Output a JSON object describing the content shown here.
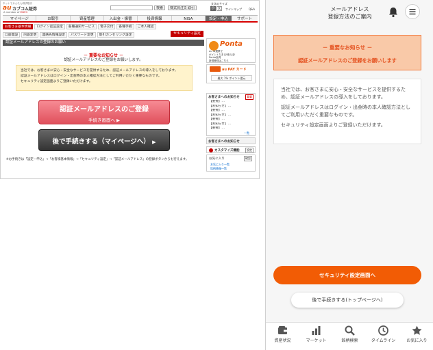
{
  "desktop": {
    "brand": {
      "small_text": "ネットでかんたん株式取引",
      "logo_au": "au",
      "logo_name": "カブコム証券",
      "member": "A member of",
      "mufg": "MUFG"
    },
    "search": {
      "button": "検索",
      "stock_price": "株式買注文",
      "trade": "取引",
      "font_size_label": "文字のサイズ",
      "font_small": "小",
      "font_large": "大",
      "sitemap": "サイトマップ",
      "qa": "Q&A"
    },
    "nav_main": [
      "マイページ",
      "お取引",
      "資産管理",
      "入出金・振替",
      "投資情報",
      "NISA"
    ],
    "nav_right": [
      "設定・申込",
      "サポート"
    ],
    "sub_nav_1": [
      "お客さま基本情報",
      "ログイン認証設定",
      "各種通知サービス",
      "電子交付",
      "各種手続",
      "ご本人確認"
    ],
    "sub_nav_1_right": "セキュリティ設定",
    "sub_nav_2": [
      "口座開設",
      "内容変更",
      "連絡先情報設定",
      "パスワード変更",
      "取引カンセリング設定"
    ],
    "page_title": "認証メールアドレスの登録のお願い",
    "notice_head": "－ 重要なお知らせ －",
    "notice_sub": "認証メールアドレスのご登録をお願いします。",
    "body_lines": [
      "当社では、お客さまに安心・安全なサービスを提供するため、認証メールアドレスの導入をしております。",
      "認証メールアドレスはログイン・出金時の本人確認方法としてご利用いただく重要なものです。",
      "セキュリティ設定画面よりご登録いただけます。"
    ],
    "register_button": {
      "main": "認証メールアドレスのご登録",
      "sub": "手続き画面へ"
    },
    "later_button": "後で手続きする（マイページへ）",
    "footnote": "※お手続きは「設定・申込」→「お客様基本情報」→「セキュリティ設定」→「認証メールアドレス」の登録ボタンからも行えます。",
    "sidebar": {
      "ponta_logo": "Ponta",
      "ponta_text": [
        "au ID連携で",
        "ポイントたまる!使える!",
        "Ponta会員",
        "新規登録はこちら"
      ],
      "aupay_label": "au PAY カード",
      "aupay_button": "最大 1% ポイント還元",
      "notices_title": "お客さまへのお知らせ",
      "notices_badge": "重要",
      "notices_items": [
        "【重要】…",
        "【お知らせ】…",
        "【重要】…",
        "【お知らせ】…",
        "【重要】…",
        "【お知らせ】…",
        "【重要】…"
      ],
      "notices_more": "一覧",
      "second_title": "お客さまへのお知らせ",
      "second_items": [
        "…",
        "…",
        "…",
        "…",
        "…",
        "…",
        "…",
        "…",
        "…",
        "…"
      ],
      "custom_label": "カスタマイズ機能",
      "custom_btn": "設定",
      "fav_label": "お気に入り",
      "fav_btn": "確認",
      "fav_items": [
        "お気に入り一覧",
        "銘柄情報一覧"
      ]
    }
  },
  "mobile": {
    "title_line1": "メールアドレス",
    "title_line2": "登録方法のご案内",
    "notice_head": "－ 重要なお知らせ －",
    "notice_body": "認証メールアドレスのご登録をお願いします",
    "para1": "当社では、お客さまに安心・安全なサービスを提供するため、認証メールアドレスの導入をしております。",
    "para2": "認証メールアドレスはログイン・出金時の本人確認方法としてご利用いただく重要なものです。",
    "para3": "セキュリティ設定画面よりご登録いただけます。",
    "primary_button": "セキュリティ設定画面へ",
    "secondary_button": "後で手続きする(トップページへ)",
    "tabs": [
      "資産状況",
      "マーケット",
      "銘柄検索",
      "タイムライン",
      "お気に入り"
    ],
    "colors": {
      "accent": "#f25c05",
      "notice_bg": "#f9c9a8",
      "notice_border": "#f27a3e",
      "notice_text": "#e4511f"
    }
  }
}
